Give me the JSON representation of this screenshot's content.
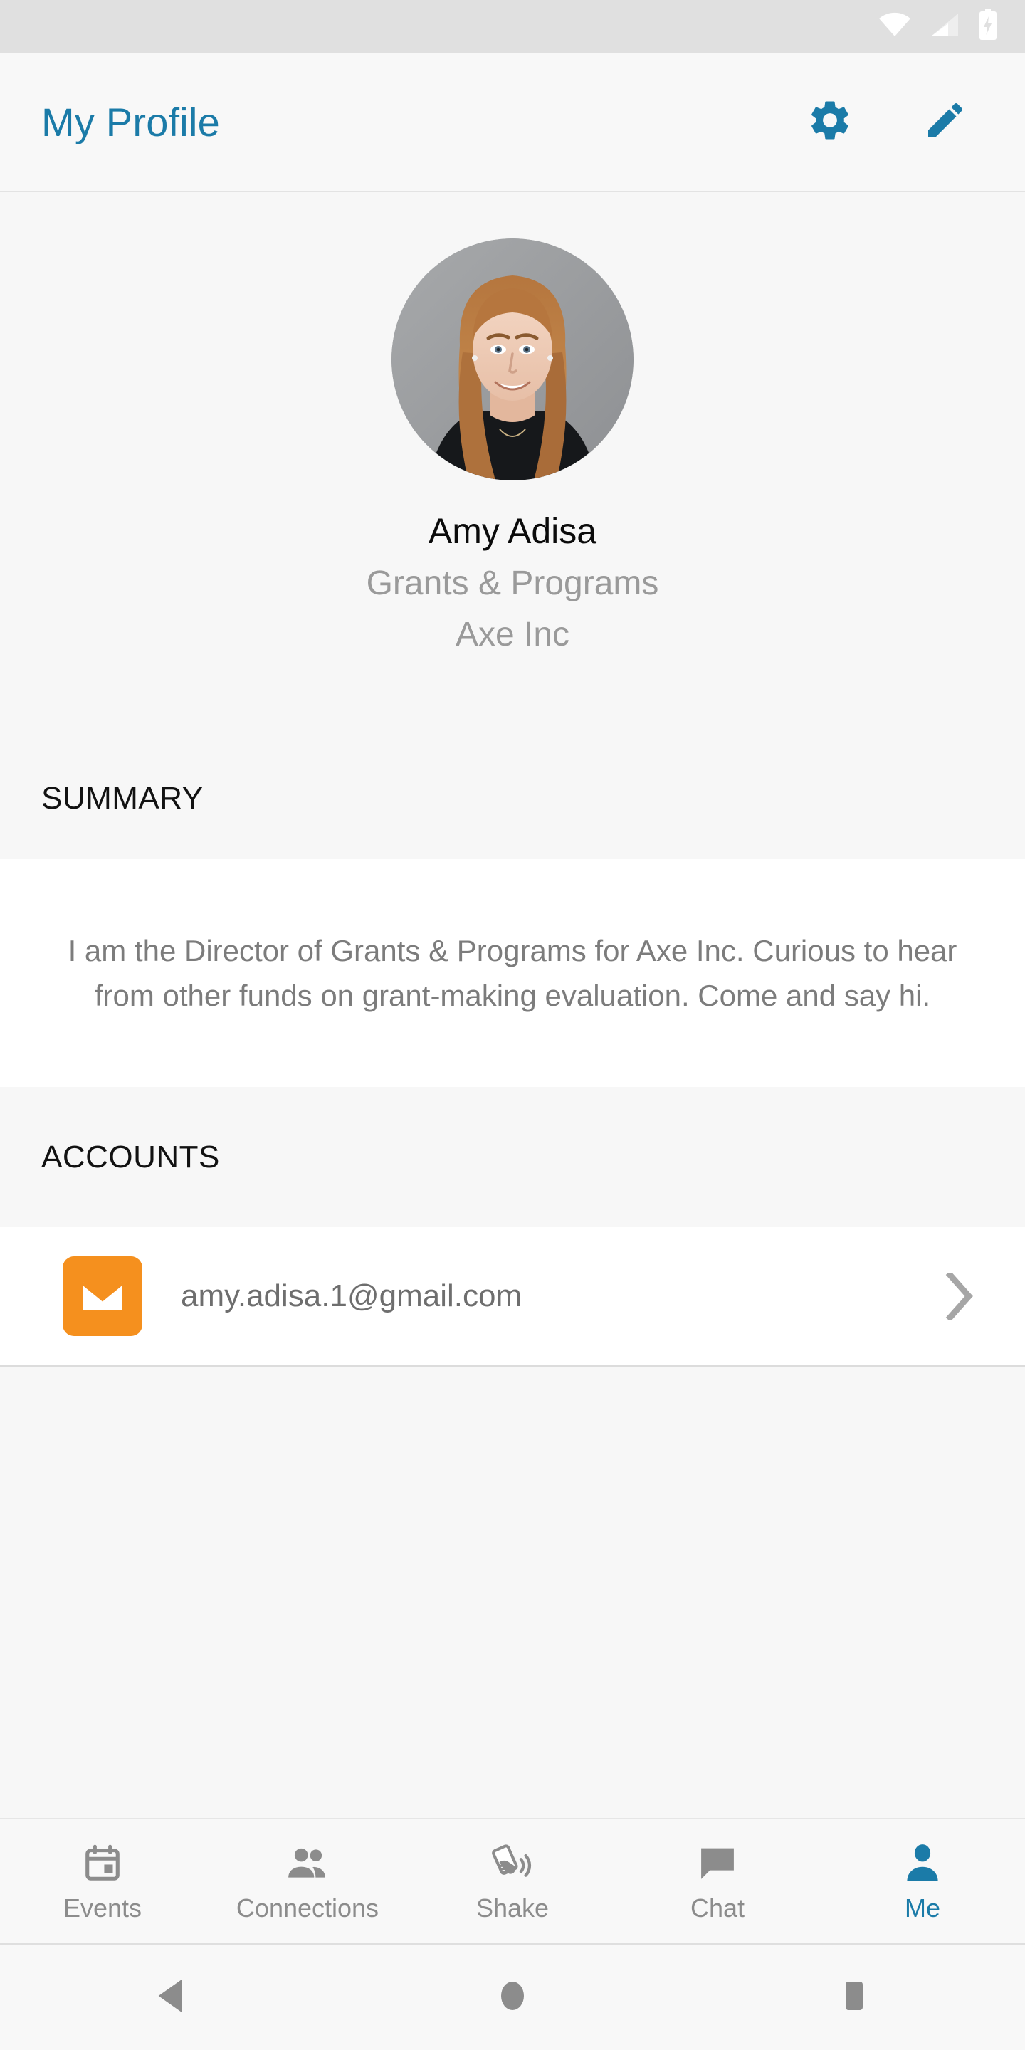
{
  "statusbar": {
    "icons": [
      "wifi-icon",
      "cellular-signal-icon",
      "battery-charging-icon"
    ]
  },
  "header": {
    "title": "My Profile",
    "settings_icon": "gear-icon",
    "edit_icon": "pencil-icon",
    "accent_color": "#1B7BA8"
  },
  "profile": {
    "avatar_alt": "profile-photo",
    "name": "Amy Adisa",
    "role": "Grants & Programs",
    "organization": "Axe Inc"
  },
  "summary": {
    "heading": "SUMMARY",
    "body": "I am the Director of Grants & Programs for Axe Inc. Curious to hear from other funds on grant-making evaluation. Come and say hi."
  },
  "accounts": {
    "heading": "ACCOUNTS",
    "items": [
      {
        "icon": "email-icon",
        "icon_color": "#F5901E",
        "value": "amy.adisa.1@gmail.com",
        "chevron": "chevron-right-icon"
      }
    ]
  },
  "tabbar": {
    "items": [
      {
        "label": "Events",
        "icon": "calendar-icon",
        "active": false
      },
      {
        "label": "Connections",
        "icon": "people-icon",
        "active": false
      },
      {
        "label": "Shake",
        "icon": "shake-phone-icon",
        "active": false
      },
      {
        "label": "Chat",
        "icon": "chat-bubble-icon",
        "active": false
      },
      {
        "label": "Me",
        "icon": "person-icon",
        "active": true
      }
    ],
    "active_color": "#1B7BA8",
    "inactive_color": "#8C8C8C"
  },
  "navbar": {
    "back": "back-triangle-icon",
    "home": "home-circle-icon",
    "recents": "recents-square-icon"
  }
}
